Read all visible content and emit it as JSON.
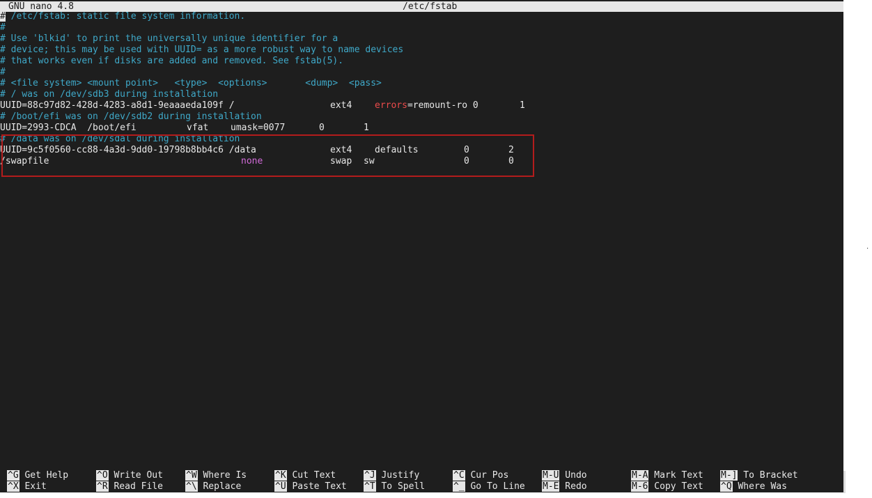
{
  "titlebar": {
    "app": "GNU nano 4.8",
    "filename": "/etc/fstab"
  },
  "lines": {
    "l1": "/etc/fstab: static file system information.",
    "l1_cursor": "#",
    "l2": "#",
    "l3": "# Use 'blkid' to print the universally unique identifier for a",
    "l4": "# device; this may be used with UUID= as a more robust way to name devices",
    "l5": "# that works even if disks are added and removed. See fstab(5).",
    "l6": "#",
    "l7": "# <file system> <mount point>   <type>  <options>       <dump>  <pass>",
    "l8": "# / was on /dev/sdb3 during installation",
    "l9": {
      "fs": "UUID=88c97d82-428d-4283-a8d1-9eaaaeda109f /",
      "type": "ext4",
      "opt_a": "errors",
      "opt_b": "=remount-ro 0",
      "pass": "1"
    },
    "l10": "# /boot/efi was on /dev/sdb2 during installation",
    "l11": {
      "fs": "UUID=2993-CDCA  /boot/efi",
      "type": "vfat",
      "opts": "umask=0077",
      "dump": "0",
      "pass": "1"
    },
    "l12": "# /data was on /dev/sdal during installation",
    "l13": {
      "fs": "UUID=9c5f0560-cc88-4a3d-9dd0-19798b8bb4c6 /data",
      "type": "ext4",
      "opts": "defaults",
      "dump": "0",
      "pass": "2"
    },
    "l14": {
      "fs": "/swapfile",
      "mount": "none",
      "type": "swap",
      "opts": "sw",
      "dump": "0",
      "pass": "0"
    }
  },
  "shortcuts": [
    {
      "key": "^G",
      "label": "Get Help"
    },
    {
      "key": "^O",
      "label": "Write Out"
    },
    {
      "key": "^W",
      "label": "Where Is"
    },
    {
      "key": "^K",
      "label": "Cut Text"
    },
    {
      "key": "^J",
      "label": "Justify"
    },
    {
      "key": "^C",
      "label": "Cur Pos"
    },
    {
      "key": "M-U",
      "label": "Undo"
    },
    {
      "key": "M-A",
      "label": "Mark Text"
    },
    {
      "key": "M-]",
      "label": "To Bracket"
    },
    {
      "key": "^X",
      "label": "Exit"
    },
    {
      "key": "^R",
      "label": "Read File"
    },
    {
      "key": "^\\",
      "label": "Replace"
    },
    {
      "key": "^U",
      "label": "Paste Text"
    },
    {
      "key": "^T",
      "label": "To Spell"
    },
    {
      "key": "^_",
      "label": "Go To Line"
    },
    {
      "key": "M-E",
      "label": "Redo"
    },
    {
      "key": "M-6",
      "label": "Copy Text"
    },
    {
      "key": "^Q",
      "label": "Where Was"
    }
  ],
  "colors": {
    "comment": "#3fa9c9",
    "text": "#e8e8e8",
    "error_keyword": "#ec4b4b",
    "none_keyword": "#d26bd9",
    "highlight_box": "#b41c1c"
  },
  "side_mark": "."
}
